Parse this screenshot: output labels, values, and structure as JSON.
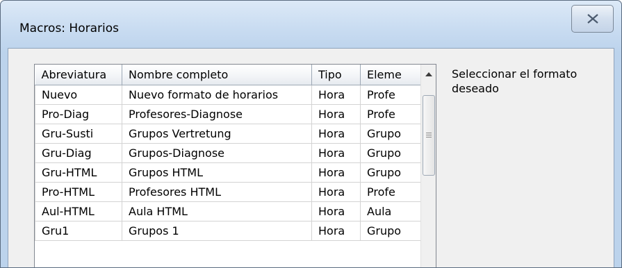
{
  "window": {
    "title": "Macros: Horarios"
  },
  "table": {
    "columns": [
      "Abreviatura",
      "Nombre completo",
      "Tipo",
      "Eleme"
    ],
    "rows": [
      [
        "Nuevo",
        "Nuevo formato de horarios",
        "Hora",
        "Profe"
      ],
      [
        "Pro-Diag",
        "Profesores-Diagnose",
        "Hora",
        "Profe"
      ],
      [
        "Gru-Susti",
        "Grupos Vertretung",
        "Hora",
        "Grupo"
      ],
      [
        "Gru-Diag",
        "Grupos-Diagnose",
        "Hora",
        "Grupo"
      ],
      [
        "Gru-HTML",
        "Grupos HTML",
        "Hora",
        "Grupo"
      ],
      [
        "Pro-HTML",
        "Profesores HTML",
        "Hora",
        "Profe"
      ],
      [
        "Aul-HTML",
        "Aula HTML",
        "Hora",
        "Aula"
      ],
      [
        "Gru1",
        "Grupos 1",
        "Hora",
        "Grupo"
      ]
    ]
  },
  "hint": "Seleccionar el formato deseado",
  "icons": {
    "close": "close-icon",
    "scroll_up": "chevron-up-icon",
    "grip": "scroll-grip-icon"
  }
}
